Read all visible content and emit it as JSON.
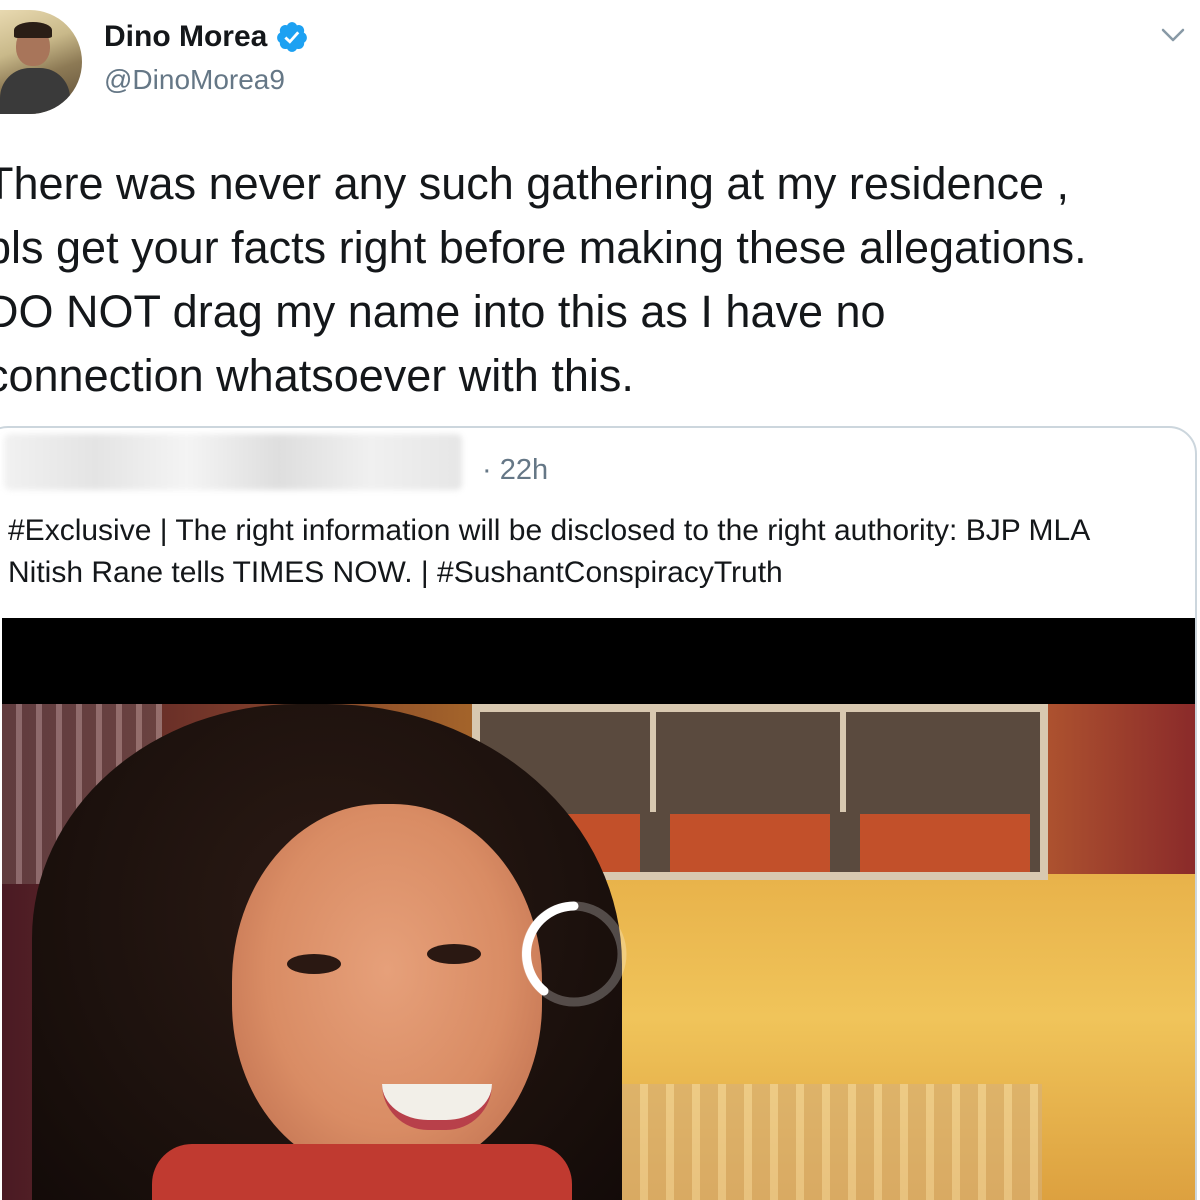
{
  "author": {
    "display_name": "Dino Morea",
    "handle": "@DinoMorea9",
    "verified": true,
    "avatar_icon": "avatar-photo"
  },
  "tweet": {
    "lines": [
      "There was never any such gathering at my residence ,",
      "pls get your facts right before making these allegations.",
      "DO NOT drag my name into this as I have no",
      "connection whatsoever with this."
    ]
  },
  "quoted_tweet": {
    "time": "· 22h",
    "text_lines": [
      "#Exclusive | The right information will be disclosed to the right authority: BJP MLA",
      "Nitish Rane tells TIMES NOW. | #SushantConspiracyTruth"
    ],
    "media_state": "loading"
  },
  "icons": {
    "verified": "verified-badge-icon",
    "more": "chevron-down-icon",
    "loading": "loading-spinner-icon"
  },
  "colors": {
    "verified_blue": "#1da1f2",
    "text_primary": "#14171a",
    "text_secondary": "#657786",
    "border": "#ccd6dd"
  }
}
